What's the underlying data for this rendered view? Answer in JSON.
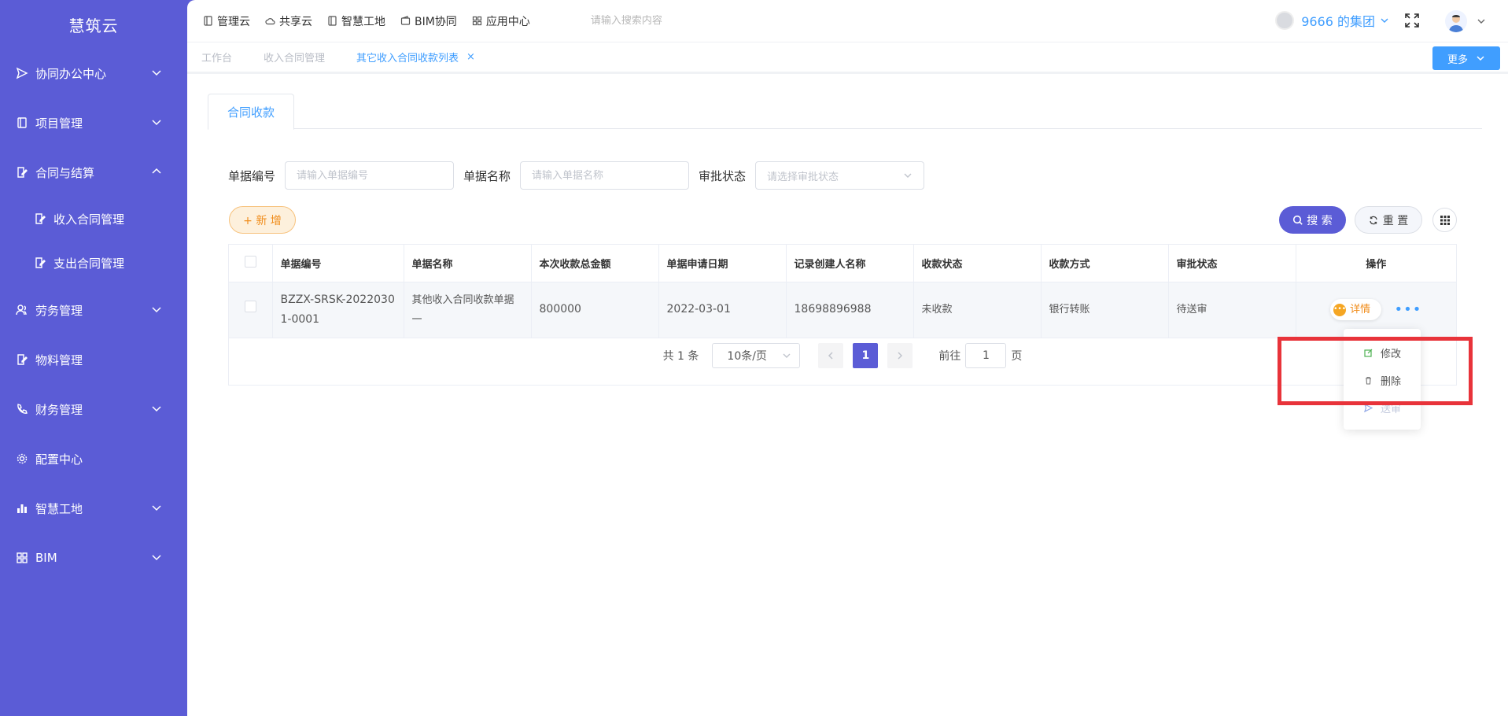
{
  "sidebar": {
    "logo": "慧筑云",
    "items": [
      {
        "label": "协同办公中心"
      },
      {
        "label": "项目管理"
      },
      {
        "label": "合同与结算"
      },
      {
        "label": "收入合同管理"
      },
      {
        "label": "支出合同管理"
      },
      {
        "label": "劳务管理"
      },
      {
        "label": "物料管理"
      },
      {
        "label": "财务管理"
      },
      {
        "label": "配置中心"
      },
      {
        "label": "智慧工地"
      },
      {
        "label": "BIM"
      }
    ]
  },
  "topbar": {
    "links": [
      "管理云",
      "共享云",
      "智慧工地",
      "BIM协同",
      "应用中心"
    ],
    "search_placeholder": "请输入搜索内容",
    "org_name": "9666 的集团"
  },
  "tabs": {
    "items": [
      "工作台",
      "收入合同管理",
      "其它收入合同收款列表"
    ],
    "close": "×",
    "more_label": "更多"
  },
  "content": {
    "tab_label": "合同收款",
    "filters": {
      "code_label": "单据编号",
      "code_placeholder": "请输入单据编号",
      "name_label": "单据名称",
      "name_placeholder": "请输入单据名称",
      "status_label": "审批状态",
      "status_placeholder": "请选择审批状态"
    },
    "add_label": "+ 新 增",
    "search_label": "搜 索",
    "reset_label": "重 置"
  },
  "table": {
    "headers": [
      "单据编号",
      "单据名称",
      "本次收款总金额",
      "单据申请日期",
      "记录创建人名称",
      "收款状态",
      "收款方式",
      "审批状态",
      "操作"
    ],
    "rows": [
      {
        "code": "BZZX-SRSK-20220301-0001",
        "name": "其他收入合同收款单据一",
        "amount": "800000",
        "date": "2022-03-01",
        "creator": "18698896988",
        "receipt_status": "未收款",
        "method": "银行转账",
        "approval": "待送审",
        "detail_label": "详情",
        "more": "•••"
      }
    ]
  },
  "pager": {
    "total": "共 1 条",
    "page_size": "10条/页",
    "current": "1",
    "goto_prefix": "前往",
    "goto_value": "1",
    "goto_suffix": "页"
  },
  "dropdown": {
    "items": [
      "修改",
      "删除",
      "送审"
    ]
  },
  "colors": {
    "sidebar_bg": "#5b5cd6",
    "accent": "#409eff",
    "warning": "#f08c1a",
    "highlight": "#e8333a"
  }
}
